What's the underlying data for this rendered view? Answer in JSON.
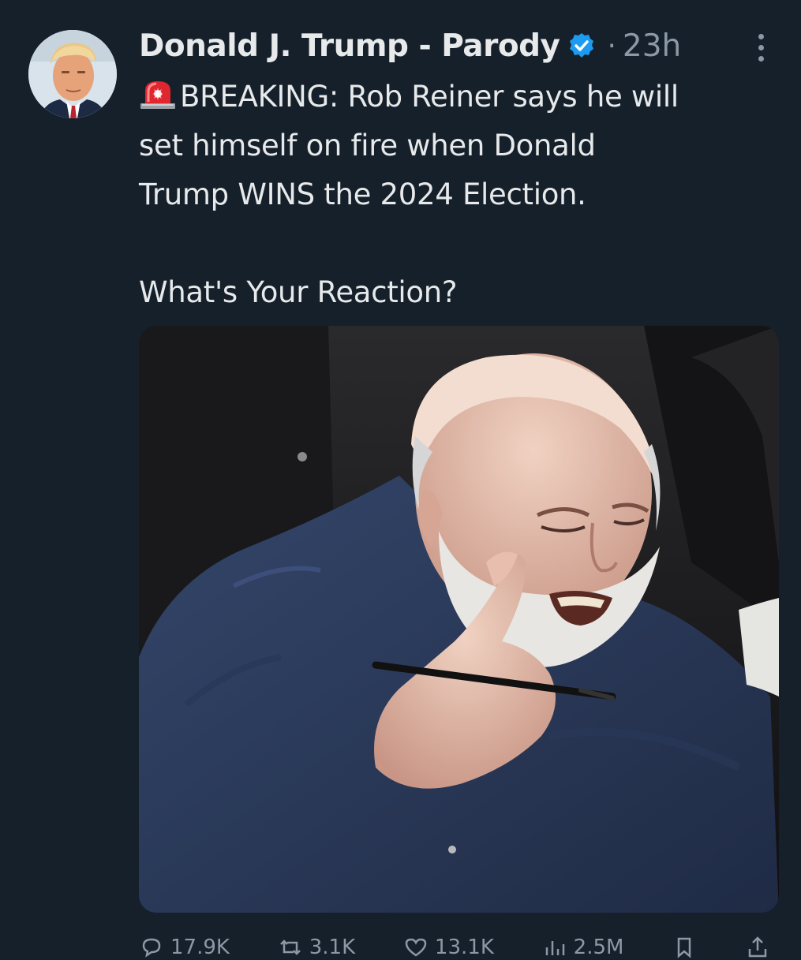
{
  "tweet": {
    "author": {
      "display_name": "Donald J. Trump - Parody",
      "verified_icon": "verified-badge-icon",
      "avatar_icon": "avatar"
    },
    "separator": "·",
    "time_ago": "23h",
    "text": {
      "line1": "BREAKING: Rob Reiner says he will",
      "line2": "set himself on fire when Donald",
      "line3": "Trump WINS the 2024 Election.",
      "line4": "What's Your Reaction?"
    },
    "media_icon": "photo-of-man-pointing",
    "actions": {
      "reply_count": "17.9K",
      "repost_count": "3.1K",
      "like_count": "13.1K",
      "views_count": "2.5M"
    }
  },
  "colors": {
    "background": "#15202b",
    "text": "#e7e9ea",
    "muted": "#8b98a5",
    "verified": "#1d9bf0"
  }
}
